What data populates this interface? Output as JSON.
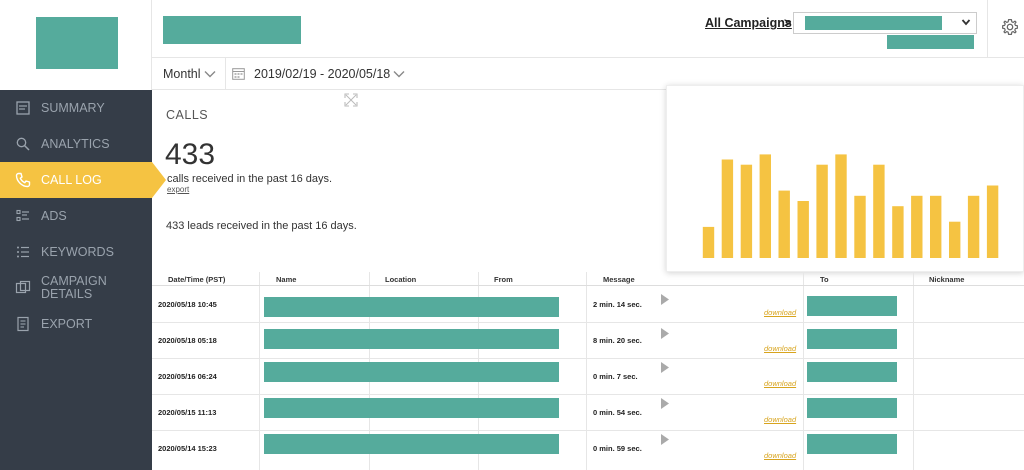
{
  "colors": {
    "accent": "#f5c342",
    "sidebar": "#353d48",
    "placeholder": "#55ab9c",
    "bar": "#f5c342"
  },
  "sidebar": {
    "items": [
      {
        "label": "SUMMARY",
        "icon": "summary-icon",
        "active": false
      },
      {
        "label": "ANALYTICS",
        "icon": "analytics-icon",
        "active": false
      },
      {
        "label": "CALL LOG",
        "icon": "phone-icon",
        "active": true
      },
      {
        "label": "ADS",
        "icon": "ads-icon",
        "active": false
      },
      {
        "label": "KEYWORDS",
        "icon": "keywords-icon",
        "active": false
      },
      {
        "label": "CAMPAIGN DETAILS",
        "icon": "campaign-icon",
        "active": false
      },
      {
        "label": "EXPORT",
        "icon": "export-icon",
        "active": false
      }
    ]
  },
  "header": {
    "all_campaigns": "All Campaigns",
    "separator": ">"
  },
  "filters": {
    "period": "Monthl",
    "date_range": "2019/02/19 - 2020/05/18"
  },
  "stats": {
    "section_title": "CALLS",
    "calls_count": "433",
    "calls_desc": "calls received in the past 16 days.",
    "export_label": "export",
    "leads_desc": "433 leads received in the past 16 days."
  },
  "chart_data": {
    "type": "bar",
    "values": [
      6,
      19,
      18,
      20,
      13,
      11,
      18,
      20,
      12,
      18,
      10,
      12,
      12,
      7,
      12,
      14
    ],
    "ylim": [
      0,
      22
    ],
    "grid": false,
    "title": "",
    "xlabel": "",
    "ylabel": ""
  },
  "table": {
    "columns": [
      "Date/Time (PST)",
      "Name",
      "Location",
      "From",
      "Message",
      "To",
      "Nickname"
    ],
    "rows": [
      {
        "date": "2020/05/18 10:45",
        "message": "2 min. 14 sec.",
        "download": "download"
      },
      {
        "date": "2020/05/18 05:18",
        "message": "8 min. 20 sec.",
        "download": "download"
      },
      {
        "date": "2020/05/16 06:24",
        "message": "0 min. 7 sec.",
        "download": "download"
      },
      {
        "date": "2020/05/15 11:13",
        "message": "0 min. 54 sec.",
        "download": "download"
      },
      {
        "date": "2020/05/14 15:23",
        "message": "0 min. 59 sec.",
        "download": "download"
      }
    ]
  }
}
